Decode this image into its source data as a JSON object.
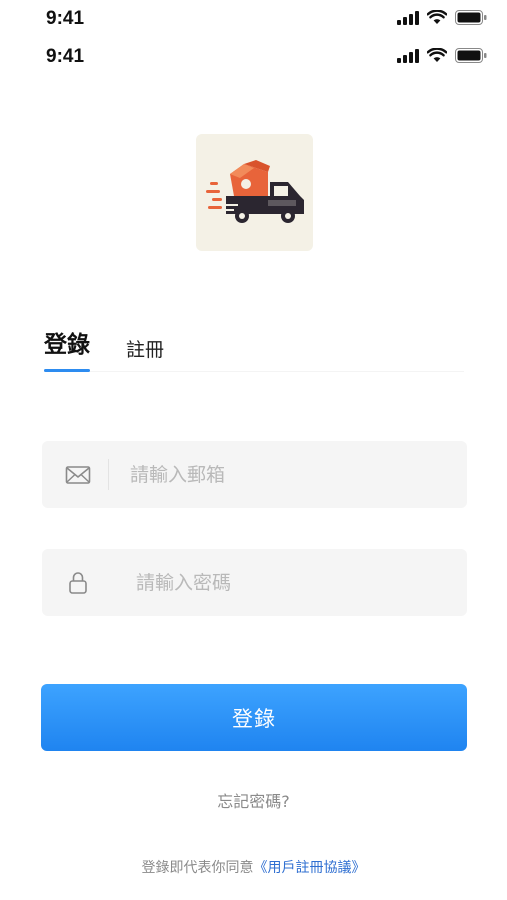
{
  "status_bar": {
    "time": "9:41",
    "time_second": "9:41"
  },
  "tabs": {
    "login": "登錄",
    "register": "註冊"
  },
  "form": {
    "email_placeholder": "請輸入郵箱",
    "email_value": "",
    "password_placeholder": "請輸入密碼",
    "password_value": ""
  },
  "actions": {
    "login_button": "登錄",
    "forgot_password": "忘記密碼?"
  },
  "agreement": {
    "prefix": "登錄即代表你同意",
    "link": "《用戶註冊協議》"
  },
  "icons": {
    "signal": "cellular-signal-icon",
    "wifi": "wifi-icon",
    "battery": "battery-icon",
    "email": "envelope-icon",
    "password": "lock-icon"
  },
  "colors": {
    "accent": "#2d8cf0",
    "button_top": "#3da3ff",
    "button_bottom": "#1f84f0",
    "field_bg": "#f5f5f5",
    "link": "#2f6fd1",
    "logo_bg": "#f4f1e6"
  }
}
